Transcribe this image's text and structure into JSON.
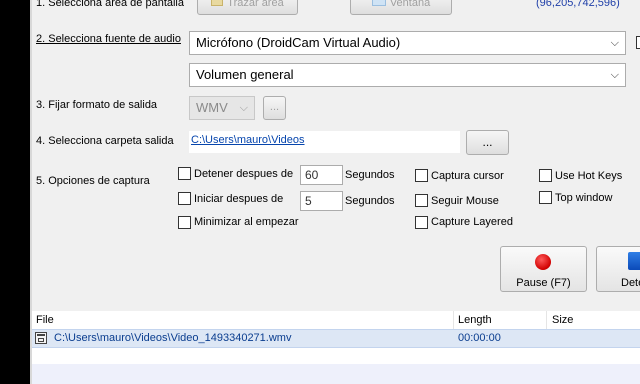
{
  "steps": {
    "s1": "1. Selecciona area de pantalla",
    "s2": "2. Selecciona fuente de audio",
    "s3": "3. Fijar formato de salida",
    "s4": "4. Selecciona carpeta salida",
    "s5": "5. Opciones de captura"
  },
  "area": {
    "trazar_label": "Trazar área",
    "ventana_label": "Ventana",
    "coords": "(96,205,742,596)"
  },
  "audio": {
    "source": "Micrófono (DroidCam Virtual Audio)",
    "volume": "Volumen general"
  },
  "format": {
    "value": "WMV",
    "more_label": "..."
  },
  "folder": {
    "path": "C:\\Users\\mauro\\Videos",
    "browse_label": "..."
  },
  "options": {
    "stop_after_label": "Detener despues de",
    "stop_after_value": "60",
    "stop_unit": "Segundos",
    "start_after_label": "Iniciar despues de",
    "start_after_value": "5",
    "start_unit": "Segundos",
    "minimize_label": "Minimizar al empezar",
    "capture_cursor_label": "Captura cursor",
    "follow_mouse_label": "Seguir Mouse",
    "capture_layered_label": "Capture Layered",
    "hotkeys_label": "Use Hot Keys",
    "top_window_label": "Top window"
  },
  "controls": {
    "pause_label": "Pause (F7)",
    "stop_label": "Dete"
  },
  "files": {
    "columns": [
      "File",
      "Length",
      "Size"
    ],
    "rows": [
      {
        "file": "C:\\Users\\mauro\\Videos\\Video_1493340271.wmv",
        "length": "00:00:00",
        "size": ""
      }
    ]
  },
  "colors": {
    "coords": "#1f3fa8",
    "record_red": "#e00000",
    "row_selected": "#dde7f5",
    "length_blue": "#0a3d8f"
  }
}
